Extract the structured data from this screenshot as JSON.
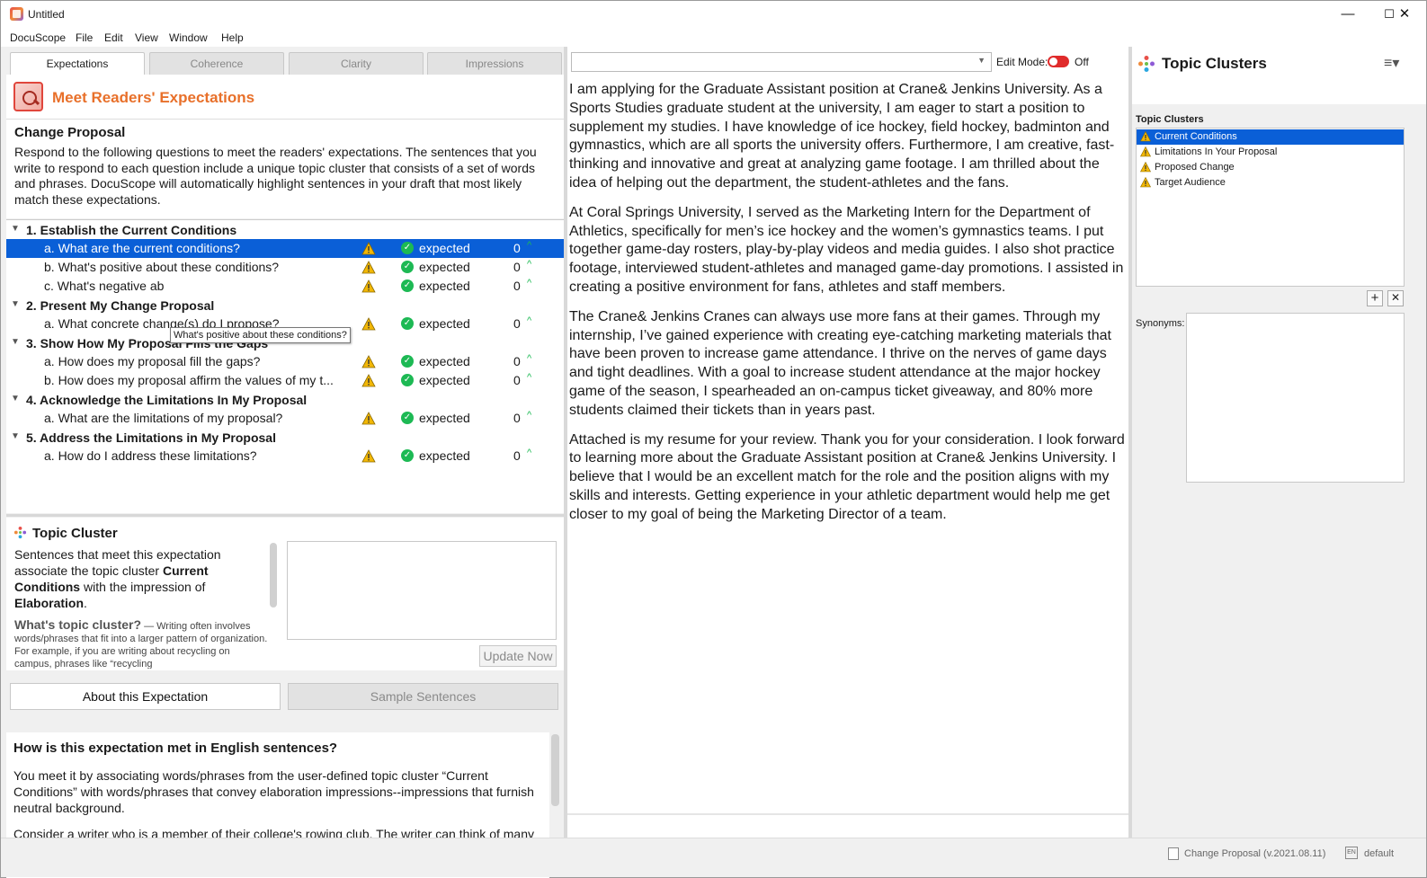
{
  "window": {
    "title": "Untitled",
    "minimize": "—",
    "maximize": "☐",
    "close": "✕"
  },
  "menu": [
    "DocuScope",
    "File",
    "Edit",
    "View",
    "Window",
    "Help"
  ],
  "tabs": [
    "Expectations",
    "Coherence",
    "Clarity",
    "Impressions"
  ],
  "expectations": {
    "heading": "Meet Readers' Expectations",
    "proposal_title": "Change Proposal",
    "proposal_desc": "Respond to the following questions to meet the readers' expectations. The sentences that you write to respond to each question include a unique topic cluster that consists of a set of words and phrases. DocuScope will automatically highlight sentences in your draft that most likely match these expectations."
  },
  "tree": {
    "groups": [
      {
        "label": "1. Establish the Current Conditions",
        "items": [
          {
            "q": "a. What are the current conditions?",
            "status": "expected",
            "count": "0",
            "selected": true
          },
          {
            "q": "b. What's positive about these conditions?",
            "status": "expected",
            "count": "0"
          },
          {
            "q": "c. What's negative ab",
            "status": "expected",
            "count": "0"
          }
        ]
      },
      {
        "label": "2. Present My Change Proposal",
        "items": [
          {
            "q": "a. What concrete change(s) do I propose?",
            "status": "expected",
            "count": "0"
          }
        ]
      },
      {
        "label": "3. Show How My Proposal Fills the Gaps",
        "items": [
          {
            "q": "a. How does my proposal fill the gaps?",
            "status": "expected",
            "count": "0"
          },
          {
            "q": "b. How does my proposal affirm the values of my t...",
            "status": "expected",
            "count": "0"
          }
        ]
      },
      {
        "label": "4. Acknowledge the Limitations In My Proposal",
        "items": [
          {
            "q": "a. What are the limitations of my proposal?",
            "status": "expected",
            "count": "0"
          }
        ]
      },
      {
        "label": "5. Address the Limitations in My Proposal",
        "items": [
          {
            "q": "a. How do I address these limitations?",
            "status": "expected",
            "count": "0"
          }
        ]
      }
    ],
    "tooltip": "What's positive about these conditions?"
  },
  "topic_cluster": {
    "title": "Topic Cluster",
    "text_pre": "Sentences that meet this expectation associate the topic cluster ",
    "cluster": "Current Conditions",
    "text_mid": " with the impression of ",
    "impression": "Elaboration",
    "text_post": ".",
    "help_title": "What's topic cluster?",
    "help_text": " — Writing often involves words/phrases that fit into a larger pattern of organization. For example, if you are writing about recycling on campus, phrases like “recycling",
    "update_button": "Update Now"
  },
  "bottom_tabs": [
    "About this Expectation",
    "Sample Sentences"
  ],
  "about": {
    "heading": "How is this expectation met in English sentences?",
    "p1": "You meet it by associating words/phrases from the user-defined topic cluster “Current Conditions” with words/phrases that convey elaboration impressions--impressions that furnish neutral background.",
    "p2": "Consider a writer who is a member of their college's rowing club. The writer can think of many neutral, positive, and negative things to say about club. Neutrally, the rowing club has been in existence for decades, has at any time about twenty members, and recruits students from across campus. Positively, the rowing club has won many competitive"
  },
  "editor": {
    "edit_mode_label": "Edit Mode:",
    "edit_mode_state": "Off",
    "paragraphs": [
      "I am applying for the Graduate Assistant position at Crane& Jenkins University. As a Sports Studies graduate student at the university, I am eager to start a position to supplement my studies. I have knowledge of ice hockey, field hockey, badminton and gymnastics, which are all sports the university offers. Furthermore, I am creative, fast-thinking and innovative and great at analyzing game footage. I am thrilled about the idea of helping out the department, the student-athletes and the fans.",
      "At Coral Springs University, I served as the Marketing Intern for the Department of Athletics, specifically for men’s ice hockey and the women’s gymnastics teams. I put together game-day rosters, play-by-play videos and media guides. I also shot practice footage, interviewed student-athletes and managed game-day promotions. I assisted in creating a positive environment for fans, athletes and staff members.",
      "The Crane& Jenkins Cranes can always use more fans at their games. Through my internship, I’ve gained experience with creating eye-catching marketing materials that have been proven to increase game attendance. I thrive on the nerves of game days and tight deadlines. With a goal to increase student attendance at the major hockey game of the season, I spearheaded an on-campus ticket giveaway, and 80% more students claimed their tickets than in years past.",
      "Attached is my resume for your review. Thank you for your consideration. I look forward to learning more about the Graduate Assistant position at Crane& Jenkins University. I believe that I would be an excellent match for the role and the position aligns with my skills and interests. Getting experience in your athletic department would help me get closer to my goal of being the Marketing Director of a team."
    ]
  },
  "right_panel": {
    "title": "Topic Clusters",
    "list_label": "Topic Clusters",
    "clusters": [
      "Current Conditions",
      "Limitations In Your Proposal",
      "Proposed Change",
      "Target Audience"
    ],
    "add": "+",
    "remove": "✕",
    "synonyms_label": "Synonyms:"
  },
  "status": {
    "doc": "Change Proposal (v.2021.08.11)",
    "lang_icon": "EN",
    "lang": "default"
  },
  "colors": {
    "accent_orange": "#e8702a",
    "selection": "#0a5fd7",
    "warning": "#f2b705",
    "check": "#1db954",
    "toggle": "#e02b2b"
  }
}
